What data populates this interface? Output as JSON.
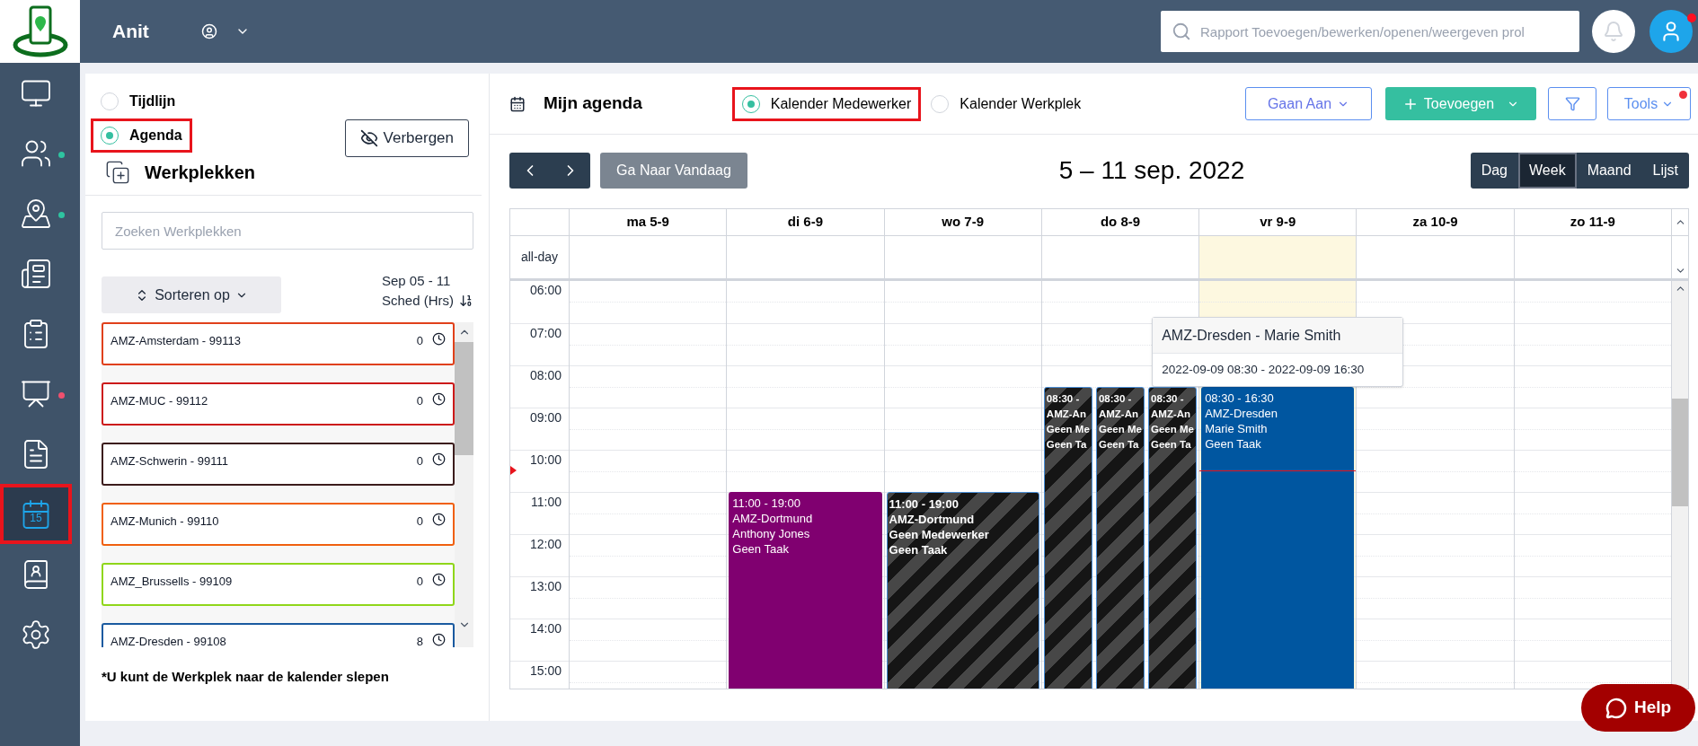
{
  "app": {
    "name": "Anit"
  },
  "header": {
    "search_placeholder": "Rapport Toevoegen/bewerken/openen/weergeven prol",
    "profile_alert": true
  },
  "sidebar": {
    "items": [
      {
        "selected": false
      },
      {
        "selected": false,
        "color": "#2ec4a0"
      },
      {
        "selected": false,
        "color": "#2ec4a0"
      },
      {
        "selected": false
      },
      {
        "selected": false
      },
      {
        "selected": false,
        "color": "#f0506e"
      },
      {
        "selected": false
      },
      {
        "selected": true,
        "annotated": true,
        "label": "15"
      },
      {
        "selected": false
      },
      {
        "selected": false
      }
    ]
  },
  "view_modes": [
    {
      "label": "Tijdlijn",
      "selected": false,
      "annotated": false
    },
    {
      "label": "Agenda",
      "selected": true,
      "annotated": true
    }
  ],
  "hide_button": "Verbergen",
  "workplaces": {
    "title": "Werkplekken",
    "search_placeholder": "Zoeken Werkplekken",
    "sort_button": "Sorteren op",
    "period": "Sep 05 - 11",
    "column": "Sched (Hrs)",
    "items": [
      {
        "name": "AMZ-Amsterdam - 99113",
        "hours": "0",
        "color": "#e0401a"
      },
      {
        "name": "AMZ-MUC - 99112",
        "hours": "0",
        "color": "#cc1a1a"
      },
      {
        "name": "AMZ-Schwerin - 99111",
        "hours": "0",
        "color": "#3b1c1c"
      },
      {
        "name": "AMZ-Munich - 99110",
        "hours": "0",
        "color": "#f0600f"
      },
      {
        "name": "AMZ_Brussells - 99109",
        "hours": "0",
        "color": "#8fd61a"
      },
      {
        "name": "AMZ-Dresden - 99108",
        "hours": "8",
        "color": "#1a5aa0"
      }
    ],
    "note": "*U kunt de Werkplek naar de kalender slepen"
  },
  "calendar": {
    "title": "Mijn agenda",
    "types": [
      {
        "label": "Kalender Medewerker",
        "selected": true,
        "annotated": true
      },
      {
        "label": "Kalender Werkplek",
        "selected": false,
        "annotated": false
      }
    ],
    "goto_button": "Gaan Aan",
    "add_button": "Toevoegen",
    "tools_button": "Tools",
    "tools_alert": true,
    "today_button": "Ga Naar Vandaag",
    "range": "5 – 11 sep. 2022",
    "views": [
      {
        "label": "Dag",
        "selected": false
      },
      {
        "label": "Week",
        "selected": true
      },
      {
        "label": "Maand",
        "selected": false
      },
      {
        "label": "Lijst",
        "selected": false
      }
    ],
    "all_day_label": "all-day",
    "hours": [
      "06:00",
      "07:00",
      "08:00",
      "09:00",
      "10:00",
      "11:00",
      "12:00",
      "13:00",
      "14:00",
      "15:00"
    ],
    "days": [
      {
        "label": "ma 5-9",
        "today": false
      },
      {
        "label": "di 6-9",
        "today": false,
        "events": [
          {
            "kind": "solid",
            "color": "#800070",
            "lines": [
              "11:00 - 19:00",
              "AMZ-Dortmund",
              "Anthony Jones",
              "Geen Taak"
            ]
          }
        ]
      },
      {
        "label": "wo 7-9",
        "today": false,
        "events": [
          {
            "kind": "striped",
            "lines": [
              "11:00 - 19:00",
              "AMZ-Dortmund",
              "Geen Medewerker",
              "Geen Taak"
            ]
          }
        ]
      },
      {
        "label": "do 8-9",
        "today": false,
        "events": [
          {
            "kind": "striped",
            "lines": [
              "08:30 -",
              "AMZ-An",
              "Geen Me",
              "Geen Ta"
            ]
          },
          {
            "kind": "striped",
            "lines": [
              "08:30 -",
              "AMZ-An",
              "Geen Me",
              "Geen Ta"
            ]
          },
          {
            "kind": "striped",
            "lines": [
              "08:30 -",
              "AMZ-An",
              "Geen Me",
              "Geen Ta"
            ]
          }
        ]
      },
      {
        "label": "vr 9-9",
        "today": true,
        "events": [
          {
            "kind": "solid",
            "color": "#0056a0",
            "lines": [
              "08:30 - 16:30",
              "AMZ-Dresden",
              "Marie Smith",
              "Geen Taak"
            ]
          }
        ],
        "tooltip": {
          "title": "AMZ-Dresden - Marie Smith",
          "text": "2022-09-09 08:30 - 2022-09-09 16:30"
        }
      },
      {
        "label": "za 10-9",
        "today": false
      },
      {
        "label": "zo 11-9",
        "today": false
      }
    ]
  },
  "help_button": "Help"
}
